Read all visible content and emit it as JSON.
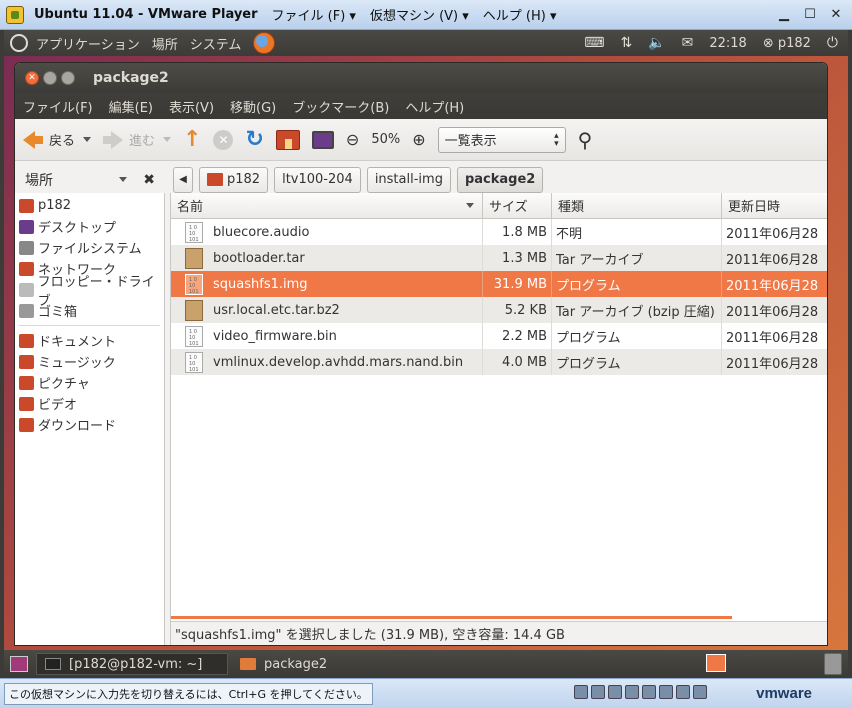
{
  "vmware": {
    "title": "Ubuntu 11.04 - VMware Player",
    "menus": [
      "ファイル (F) ▾",
      "仮想マシン (V) ▾",
      "ヘルプ (H) ▾"
    ],
    "status_message": "この仮想マシンに入力先を切り替えるには、Ctrl+G を押してください。",
    "logo": "vmware"
  },
  "ubuntu_panel": {
    "menus": [
      "アプリケーション",
      "場所",
      "システム"
    ],
    "clock": "22:18",
    "user": "p182"
  },
  "window": {
    "title": "package2",
    "menu": [
      "ファイル(F)",
      "編集(E)",
      "表示(V)",
      "移動(G)",
      "ブックマーク(B)",
      "ヘルプ(H)"
    ]
  },
  "toolbar": {
    "back_label": "戻る",
    "forward_label": "進む",
    "zoom_level": "50%",
    "view_mode": "一覧表示"
  },
  "sidebar": {
    "header": "場所",
    "items": [
      {
        "label": "p182",
        "color": "#c9492a"
      },
      {
        "label": "デスクトップ",
        "color": "#6a3c8a"
      },
      {
        "label": "ファイルシステム",
        "color": "#888888"
      },
      {
        "label": "ネットワーク",
        "color": "#c9492a"
      },
      {
        "label": "フロッピー・ドライブ",
        "color": "#aaaaaa"
      },
      {
        "label": "ゴミ箱",
        "color": "#999999"
      }
    ],
    "bookmarks": [
      {
        "label": "ドキュメント",
        "color": "#c9492a"
      },
      {
        "label": "ミュージック",
        "color": "#c9492a"
      },
      {
        "label": "ピクチャ",
        "color": "#c9492a"
      },
      {
        "label": "ビデオ",
        "color": "#c9492a"
      },
      {
        "label": "ダウンロード",
        "color": "#c9492a"
      }
    ]
  },
  "breadcrumbs": [
    "p182",
    "ltv100-204",
    "install-img",
    "package2"
  ],
  "columns": [
    "名前",
    "サイズ",
    "種類",
    "更新日時"
  ],
  "files": [
    {
      "name": "bluecore.audio",
      "size": "1.8 MB",
      "type": "不明",
      "date": "2011年06月28",
      "icon": "binary"
    },
    {
      "name": "bootloader.tar",
      "size": "1.3 MB",
      "type": "Tar アーカイブ",
      "date": "2011年06月28",
      "icon": "tar"
    },
    {
      "name": "squashfs1.img",
      "size": "31.9 MB",
      "type": "プログラム",
      "date": "2011年06月28",
      "icon": "binary",
      "selected": true
    },
    {
      "name": "usr.local.etc.tar.bz2",
      "size": "5.2 KB",
      "type": "Tar アーカイブ (bzip 圧縮)",
      "date": "2011年06月28",
      "icon": "tar"
    },
    {
      "name": "video_firmware.bin",
      "size": "2.2 MB",
      "type": "プログラム",
      "date": "2011年06月28",
      "icon": "binary"
    },
    {
      "name": "vmlinux.develop.avhdd.mars.nand.bin",
      "size": "4.0 MB",
      "type": "プログラム",
      "date": "2011年06月28",
      "icon": "binary"
    }
  ],
  "status": "\"squashfs1.img\" を選択しました (31.9 MB), 空き容量: 14.4 GB",
  "taskbar": {
    "tasks": [
      "[p182@p182-vm: ~]",
      "package2"
    ]
  },
  "colors": {
    "selection": "#f07746",
    "panel": "#3c3b37"
  }
}
